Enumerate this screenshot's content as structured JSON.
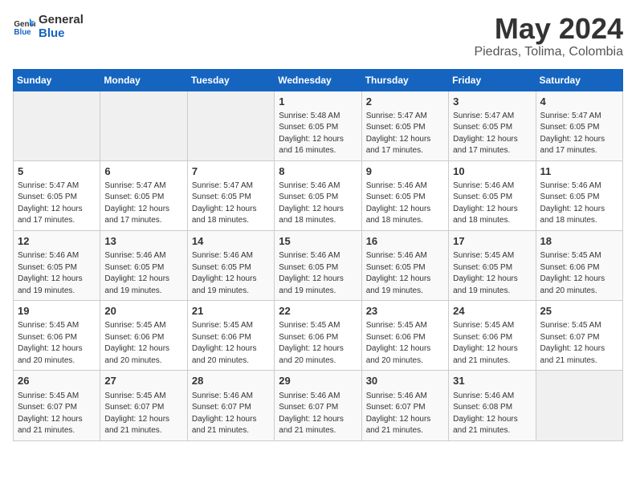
{
  "header": {
    "logo_line1": "General",
    "logo_line2": "Blue",
    "month_year": "May 2024",
    "location": "Piedras, Tolima, Colombia"
  },
  "weekdays": [
    "Sunday",
    "Monday",
    "Tuesday",
    "Wednesday",
    "Thursday",
    "Friday",
    "Saturday"
  ],
  "weeks": [
    [
      {
        "day": "",
        "info": ""
      },
      {
        "day": "",
        "info": ""
      },
      {
        "day": "",
        "info": ""
      },
      {
        "day": "1",
        "info": "Sunrise: 5:48 AM\nSunset: 6:05 PM\nDaylight: 12 hours\nand 16 minutes."
      },
      {
        "day": "2",
        "info": "Sunrise: 5:47 AM\nSunset: 6:05 PM\nDaylight: 12 hours\nand 17 minutes."
      },
      {
        "day": "3",
        "info": "Sunrise: 5:47 AM\nSunset: 6:05 PM\nDaylight: 12 hours\nand 17 minutes."
      },
      {
        "day": "4",
        "info": "Sunrise: 5:47 AM\nSunset: 6:05 PM\nDaylight: 12 hours\nand 17 minutes."
      }
    ],
    [
      {
        "day": "5",
        "info": "Sunrise: 5:47 AM\nSunset: 6:05 PM\nDaylight: 12 hours\nand 17 minutes."
      },
      {
        "day": "6",
        "info": "Sunrise: 5:47 AM\nSunset: 6:05 PM\nDaylight: 12 hours\nand 17 minutes."
      },
      {
        "day": "7",
        "info": "Sunrise: 5:47 AM\nSunset: 6:05 PM\nDaylight: 12 hours\nand 18 minutes."
      },
      {
        "day": "8",
        "info": "Sunrise: 5:46 AM\nSunset: 6:05 PM\nDaylight: 12 hours\nand 18 minutes."
      },
      {
        "day": "9",
        "info": "Sunrise: 5:46 AM\nSunset: 6:05 PM\nDaylight: 12 hours\nand 18 minutes."
      },
      {
        "day": "10",
        "info": "Sunrise: 5:46 AM\nSunset: 6:05 PM\nDaylight: 12 hours\nand 18 minutes."
      },
      {
        "day": "11",
        "info": "Sunrise: 5:46 AM\nSunset: 6:05 PM\nDaylight: 12 hours\nand 18 minutes."
      }
    ],
    [
      {
        "day": "12",
        "info": "Sunrise: 5:46 AM\nSunset: 6:05 PM\nDaylight: 12 hours\nand 19 minutes."
      },
      {
        "day": "13",
        "info": "Sunrise: 5:46 AM\nSunset: 6:05 PM\nDaylight: 12 hours\nand 19 minutes."
      },
      {
        "day": "14",
        "info": "Sunrise: 5:46 AM\nSunset: 6:05 PM\nDaylight: 12 hours\nand 19 minutes."
      },
      {
        "day": "15",
        "info": "Sunrise: 5:46 AM\nSunset: 6:05 PM\nDaylight: 12 hours\nand 19 minutes."
      },
      {
        "day": "16",
        "info": "Sunrise: 5:46 AM\nSunset: 6:05 PM\nDaylight: 12 hours\nand 19 minutes."
      },
      {
        "day": "17",
        "info": "Sunrise: 5:45 AM\nSunset: 6:05 PM\nDaylight: 12 hours\nand 19 minutes."
      },
      {
        "day": "18",
        "info": "Sunrise: 5:45 AM\nSunset: 6:06 PM\nDaylight: 12 hours\nand 20 minutes."
      }
    ],
    [
      {
        "day": "19",
        "info": "Sunrise: 5:45 AM\nSunset: 6:06 PM\nDaylight: 12 hours\nand 20 minutes."
      },
      {
        "day": "20",
        "info": "Sunrise: 5:45 AM\nSunset: 6:06 PM\nDaylight: 12 hours\nand 20 minutes."
      },
      {
        "day": "21",
        "info": "Sunrise: 5:45 AM\nSunset: 6:06 PM\nDaylight: 12 hours\nand 20 minutes."
      },
      {
        "day": "22",
        "info": "Sunrise: 5:45 AM\nSunset: 6:06 PM\nDaylight: 12 hours\nand 20 minutes."
      },
      {
        "day": "23",
        "info": "Sunrise: 5:45 AM\nSunset: 6:06 PM\nDaylight: 12 hours\nand 20 minutes."
      },
      {
        "day": "24",
        "info": "Sunrise: 5:45 AM\nSunset: 6:06 PM\nDaylight: 12 hours\nand 21 minutes."
      },
      {
        "day": "25",
        "info": "Sunrise: 5:45 AM\nSunset: 6:07 PM\nDaylight: 12 hours\nand 21 minutes."
      }
    ],
    [
      {
        "day": "26",
        "info": "Sunrise: 5:45 AM\nSunset: 6:07 PM\nDaylight: 12 hours\nand 21 minutes."
      },
      {
        "day": "27",
        "info": "Sunrise: 5:45 AM\nSunset: 6:07 PM\nDaylight: 12 hours\nand 21 minutes."
      },
      {
        "day": "28",
        "info": "Sunrise: 5:46 AM\nSunset: 6:07 PM\nDaylight: 12 hours\nand 21 minutes."
      },
      {
        "day": "29",
        "info": "Sunrise: 5:46 AM\nSunset: 6:07 PM\nDaylight: 12 hours\nand 21 minutes."
      },
      {
        "day": "30",
        "info": "Sunrise: 5:46 AM\nSunset: 6:07 PM\nDaylight: 12 hours\nand 21 minutes."
      },
      {
        "day": "31",
        "info": "Sunrise: 5:46 AM\nSunset: 6:08 PM\nDaylight: 12 hours\nand 21 minutes."
      },
      {
        "day": "",
        "info": ""
      }
    ]
  ]
}
